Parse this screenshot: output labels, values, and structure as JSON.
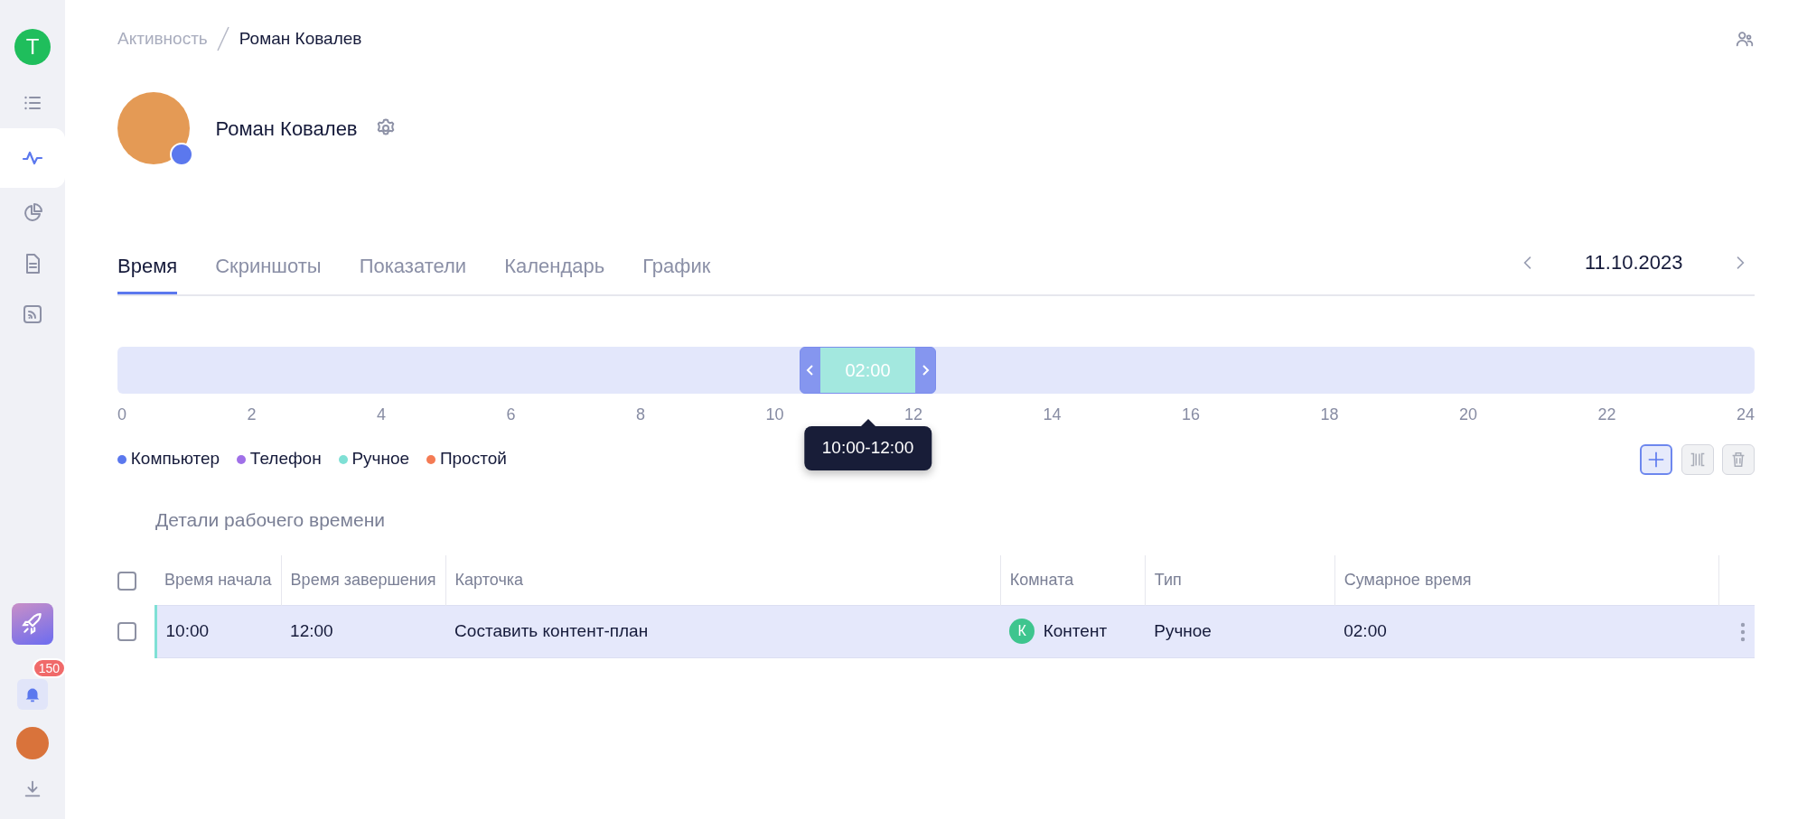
{
  "sidebar": {
    "workspace_initial": "T",
    "items": [
      {
        "selected": false
      },
      {
        "selected": true
      },
      {
        "selected": false
      },
      {
        "selected": false
      },
      {
        "selected": false
      }
    ],
    "notifications_count": "150"
  },
  "breadcrumb": [
    "Активность",
    "Роман Ковалев"
  ],
  "profile": {
    "name": "Роман Ковалев"
  },
  "tabs": [
    {
      "label": "Время",
      "selected": true
    },
    {
      "label": "Скриншоты",
      "selected": false
    },
    {
      "label": "Показатели",
      "selected": false
    },
    {
      "label": "Календарь",
      "selected": false
    },
    {
      "label": "График",
      "selected": false
    }
  ],
  "date": "11.10.2023",
  "timeline": {
    "segment_label": "02:00",
    "tooltip": "10:00-12:00",
    "ticks": [
      "0",
      "2",
      "4",
      "6",
      "8",
      "10",
      "12",
      "14",
      "16",
      "18",
      "20",
      "22",
      "24"
    ]
  },
  "legend": [
    {
      "label": "Компьютер",
      "color": "#5b78ee"
    },
    {
      "label": "Телефон",
      "color": "#a070e8"
    },
    {
      "label": "Ручное",
      "color": "#7fe0d5"
    },
    {
      "label": "Простой",
      "color": "#f47b54"
    }
  ],
  "toolbar": [
    {
      "kind": "add",
      "disabled": false
    },
    {
      "kind": "split",
      "disabled": true
    },
    {
      "kind": "delete",
      "disabled": true
    }
  ],
  "section_title": "Детали рабочего времени",
  "table": {
    "all_checked": false,
    "columns": [
      "Время начала",
      "Время завершения",
      "Карточка",
      "Комната",
      "Тип",
      "Сумарное время"
    ],
    "rows": [
      {
        "checked": false,
        "start": "10:00",
        "end": "12:00",
        "card": "Составить контент-план",
        "room_initial": "К",
        "room": "Контент",
        "type": "Ручное",
        "total": "02:00"
      }
    ]
  }
}
